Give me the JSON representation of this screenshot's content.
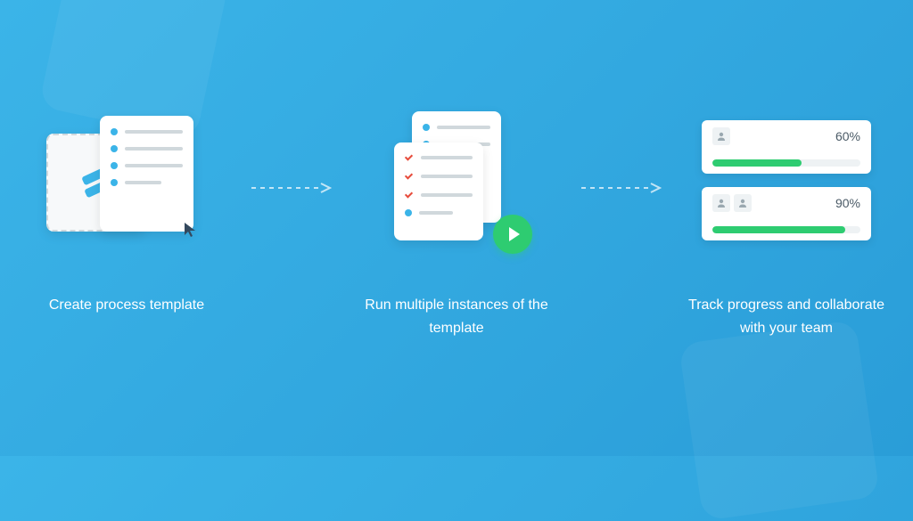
{
  "steps": [
    {
      "caption": "Create process template"
    },
    {
      "caption": "Run multiple instances of the template"
    },
    {
      "caption": "Track progress and collaborate with your team"
    }
  ],
  "progress": [
    {
      "pct": "60%",
      "width": "60%",
      "avatars": 1
    },
    {
      "pct": "90%",
      "width": "90%",
      "avatars": 2
    }
  ],
  "colors": {
    "accent": "#3bb4e8",
    "success": "#2ecc71",
    "danger": "#e74c3c"
  }
}
